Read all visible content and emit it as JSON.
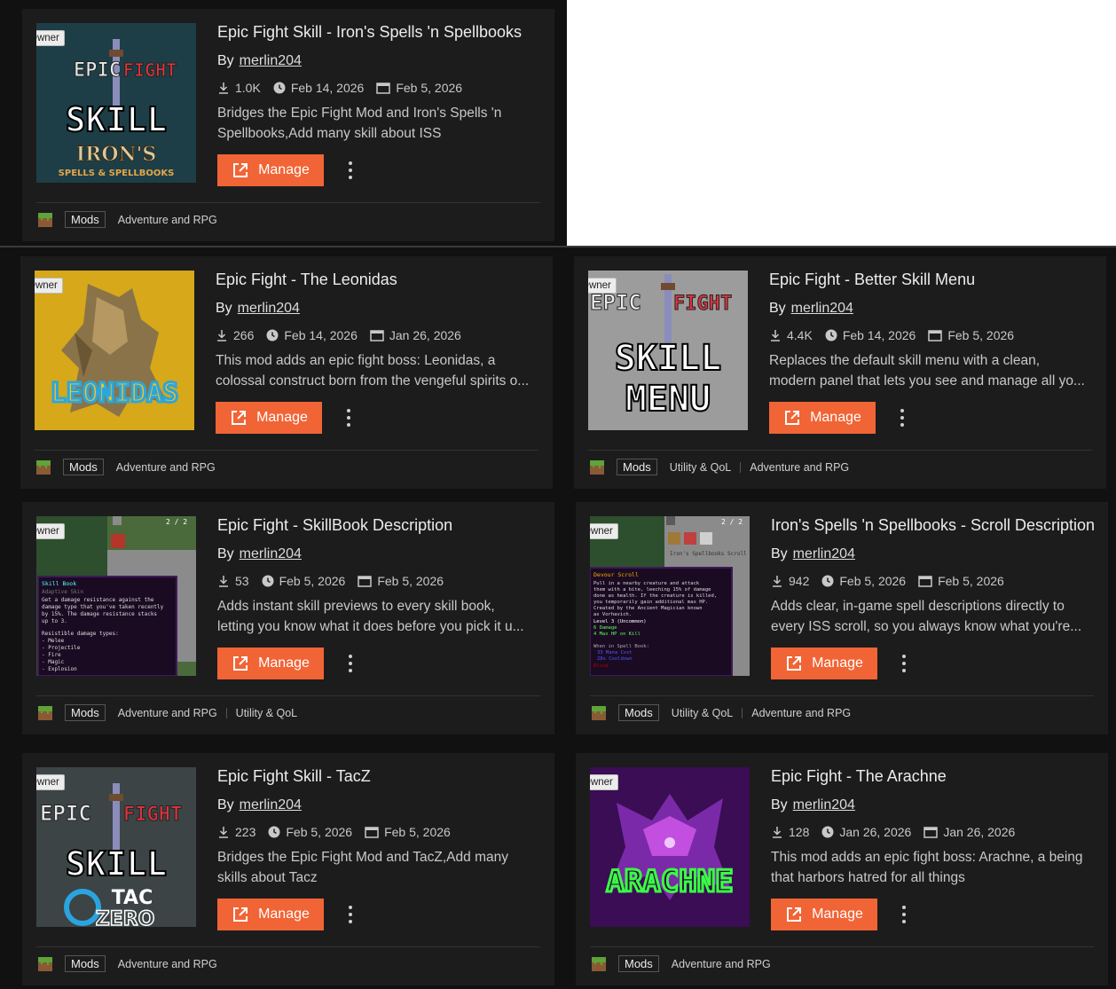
{
  "cards": [
    {
      "title": "Epic Fight Skill - Iron's Spells 'n Spellbooks",
      "by": "By",
      "author": "merlin204",
      "downloads": "1.0K",
      "updated": "Feb 14, 2026",
      "created": "Feb 5, 2026",
      "desc_lines": [
        "Bridges the Epic Fight Mod and Iron's Spells 'n",
        "Spellbooks,Add many skill about ISS"
      ],
      "manage": "Manage",
      "badge": "Owner",
      "project_type": "Mods",
      "categories": [
        "Adventure and RPG"
      ]
    },
    {
      "title": "Epic Fight - The Leonidas",
      "by": "By",
      "author": "merlin204",
      "downloads": "266",
      "updated": "Feb 14, 2026",
      "created": "Jan 26, 2026",
      "desc_lines": [
        "This mod adds an epic fight boss: Leonidas, a",
        "colossal construct born from the vengeful spirits o..."
      ],
      "manage": "Manage",
      "badge": "Owner",
      "project_type": "Mods",
      "categories": [
        "Adventure and RPG"
      ]
    },
    {
      "title": "Epic Fight - Better Skill Menu",
      "by": "By",
      "author": "merlin204",
      "downloads": "4.4K",
      "updated": "Feb 14, 2026",
      "created": "Feb 5, 2026",
      "desc_lines": [
        "Replaces the default skill menu with a clean,",
        "modern panel that lets you see and manage all yo..."
      ],
      "manage": "Manage",
      "badge": "Owner",
      "project_type": "Mods",
      "categories": [
        "Utility & QoL",
        "Adventure and RPG"
      ]
    },
    {
      "title": "Epic Fight - SkillBook Description",
      "by": "By",
      "author": "merlin204",
      "downloads": "53",
      "updated": "Feb 5, 2026",
      "created": "Feb 5, 2026",
      "desc_lines": [
        "Adds instant skill previews to every skill book,",
        "letting you know what it does before you pick it u..."
      ],
      "manage": "Manage",
      "badge": "Owner",
      "project_type": "Mods",
      "categories": [
        "Adventure and RPG",
        "Utility & QoL"
      ]
    },
    {
      "title": "Iron's Spells 'n Spellbooks - Scroll Description",
      "by": "By",
      "author": "merlin204",
      "downloads": "942",
      "updated": "Feb 5, 2026",
      "created": "Feb 5, 2026",
      "desc_lines": [
        "Adds clear, in-game spell descriptions directly to",
        "every ISS scroll, so you always know what you're..."
      ],
      "manage": "Manage",
      "badge": "Owner",
      "project_type": "Mods",
      "categories": [
        "Utility & QoL",
        "Adventure and RPG"
      ]
    },
    {
      "title": "Epic Fight Skill - TacZ",
      "by": "By",
      "author": "merlin204",
      "downloads": "223",
      "updated": "Feb 5, 2026",
      "created": "Feb 5, 2026",
      "desc_lines": [
        "Bridges the Epic Fight Mod and TacZ,Add many",
        "skills about Tacz"
      ],
      "manage": "Manage",
      "badge": "Owner",
      "project_type": "Mods",
      "categories": [
        "Adventure and RPG"
      ]
    },
    {
      "title": "Epic Fight - The Arachne",
      "by": "By",
      "author": "merlin204",
      "downloads": "128",
      "updated": "Jan 26, 2026",
      "created": "Jan 26, 2026",
      "desc_lines": [
        "This mod adds an epic fight boss: Arachne, a being",
        "that harbors hatred for all things"
      ],
      "manage": "Manage",
      "badge": "Owner",
      "project_type": "Mods",
      "categories": [
        "Adventure and RPG"
      ]
    }
  ],
  "thumbs": {
    "skill_logo": {
      "epic": "EPIC",
      "fight": "FIGHT",
      "skill": "SKILL",
      "irons": "IRON'S",
      "spells": "SPELLS & SPELLBOOKS",
      "menu": "MENU",
      "tac": "TAC",
      "zero": "ZERO"
    },
    "leonidas": "LEONIDAS",
    "arachne": "ARACHNE",
    "skillbook": {
      "page": "2 / 2",
      "name": "Skill Book",
      "sub": "Adaptive Skin",
      "l1": "Get a damage resistance against the",
      "l2": "damage type that you've taken recently",
      "l3": "by 15%. The damage resistance stacks",
      "l4": "up to 3.",
      "l5": "Resistible damage types:",
      "l6": "- Melee",
      "l7": "- Projectile",
      "l8": "- Fire",
      "l9": "- Magic",
      "l10": "- Explosion"
    },
    "scroll": {
      "page": "2 / 2",
      "header": "Iron's Spellbooks Scroll",
      "name": "Devour Scroll",
      "l1": "Pull in a nearby creature and attack",
      "l2": "them with a bite, leeching 15% of damage",
      "l3": "done as health. If the creature is killed,",
      "l4": "you temporarily gain additional max HP.",
      "l5": "Created by the Ancient Magician known",
      "l6": "as Vorhavich.",
      "l7": "Level 3 (Uncommon)",
      "l8": "6 Damage",
      "l9": "4 Max HP on Kill",
      "l10": "When in Spell Book:",
      "l11": "33 Mana Cost",
      "l12": "28s Cooldown",
      "l13": "Blood"
    }
  },
  "colors": {
    "accent": "#f16436",
    "card_bg": "#1c1c1c",
    "page_bg": "#111111"
  }
}
